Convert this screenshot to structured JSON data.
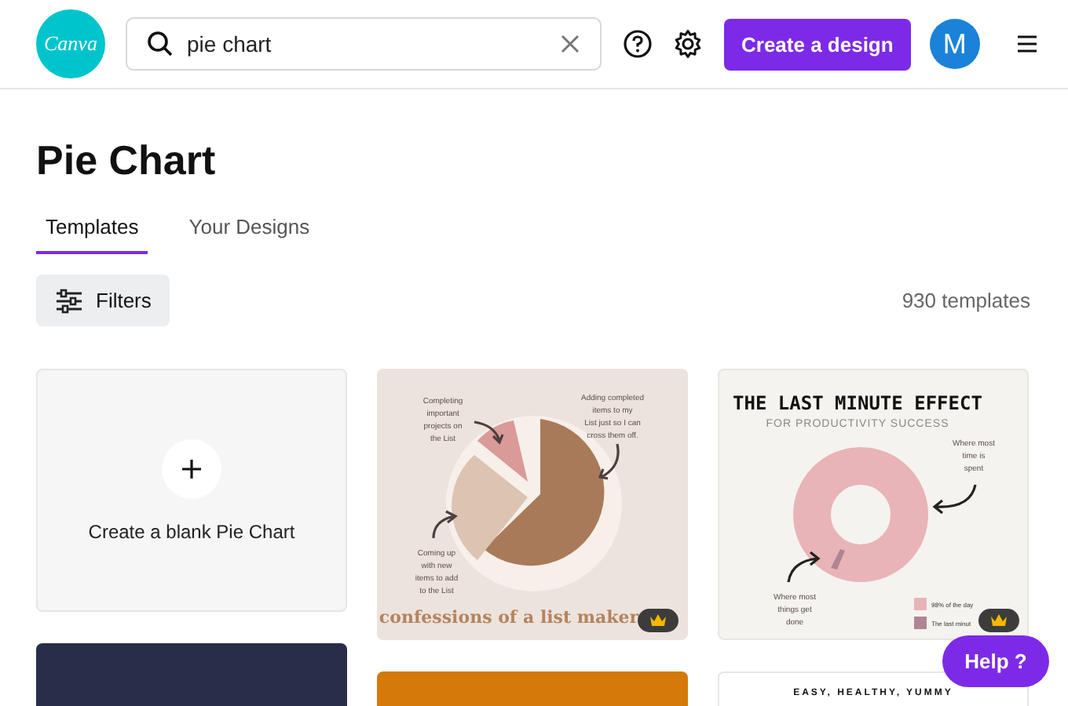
{
  "header": {
    "logo": "Canva",
    "search": {
      "value": "pie chart"
    },
    "create_button": "Create a design",
    "avatar": "M"
  },
  "page_title": "Pie Chart",
  "tabs": [
    {
      "label": "Templates",
      "selected": true
    },
    {
      "label": "Your Designs",
      "selected": false
    }
  ],
  "filters_button": "Filters",
  "template_count": "930 templates",
  "columns": [
    {
      "cards": [
        {
          "kind": "blank",
          "label": "Create a blank Pie Chart"
        },
        {
          "kind": "dark"
        }
      ]
    },
    {
      "cards": [
        {
          "kind": "pie",
          "title": "confessions of a list maker",
          "premium": true,
          "notes": [
            "Completing\nimportant\nprojects on\nthe List",
            "Adding completed\nitems to my\nList just so I can\ncross them off.",
            "Coming up\nwith new\nitems to add\nto the List"
          ]
        },
        {
          "kind": "orange"
        }
      ]
    },
    {
      "cards": [
        {
          "kind": "donut",
          "title": "THE LAST MINUTE EFFECT",
          "subtitle": "FOR PRODUCTIVITY SUCCESS",
          "premium": true,
          "notes": [
            "Where most\ntime is\nspent",
            "Where most\nthings get\ndone"
          ],
          "legend": [
            "98% of the day",
            "The last minut"
          ]
        },
        {
          "kind": "recipe",
          "title": "EASY, HEALTHY, YUMMY"
        }
      ]
    }
  ],
  "help_button": "Help ?"
}
